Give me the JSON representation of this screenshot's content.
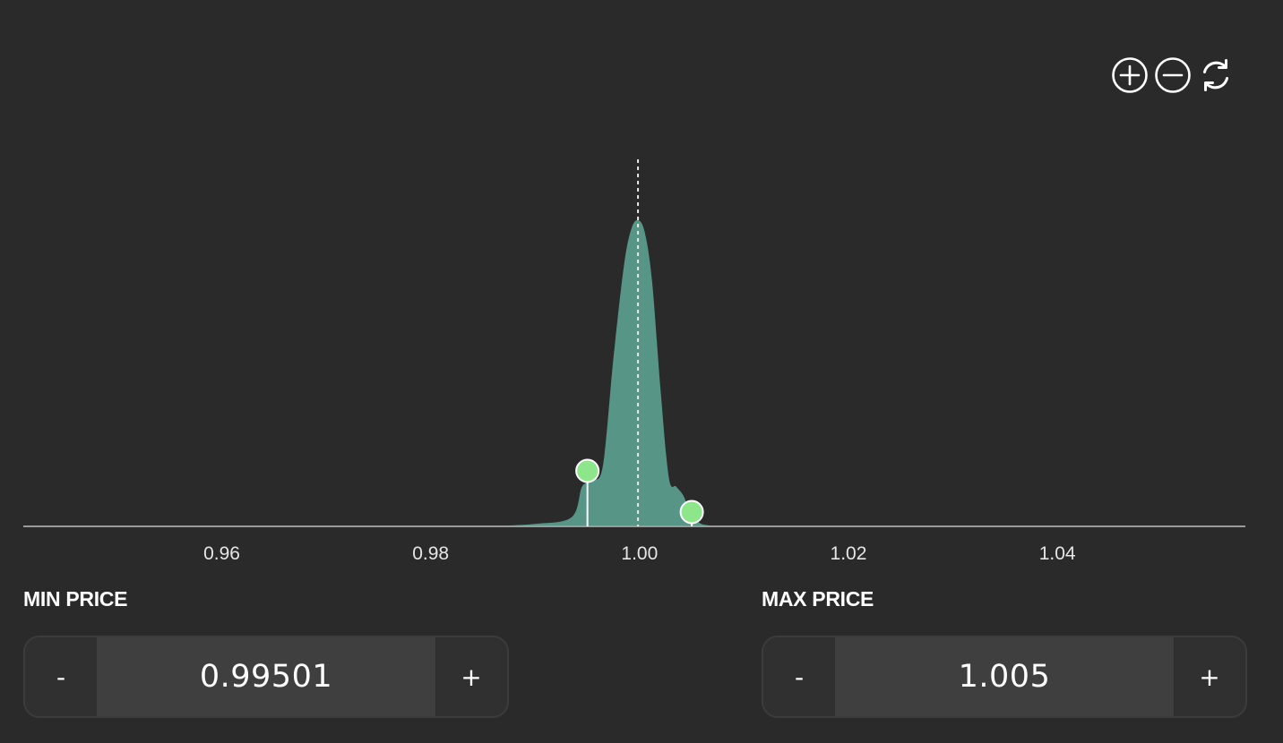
{
  "toolbar": {
    "zoom_in_icon": "plus-circle-icon",
    "zoom_out_icon": "minus-circle-icon",
    "reset_icon": "refresh-icon"
  },
  "chart_data": {
    "type": "area",
    "xlim": [
      0.941,
      1.058
    ],
    "x_ticks": [
      0.96,
      0.98,
      1.0,
      1.02,
      1.04
    ],
    "tick_labels": [
      "0.96",
      "0.98",
      "1.00",
      "1.02",
      "1.04"
    ],
    "current_price": 0.99985,
    "range_min": 0.99501,
    "range_max": 1.005,
    "x": [
      0.985,
      0.99,
      0.9935,
      0.9945,
      0.9955,
      0.9965,
      0.9975,
      0.9985,
      0.9992,
      0.99985,
      1.0005,
      1.0012,
      1.002,
      1.0028,
      1.0035,
      1.0042,
      1.0048,
      1.0058,
      1.0075,
      1.01
    ],
    "y": [
      0.0,
      0.008,
      0.03,
      0.13,
      0.15,
      0.2,
      0.55,
      0.85,
      0.97,
      1.0,
      0.96,
      0.8,
      0.45,
      0.16,
      0.13,
      0.1,
      0.05,
      0.01,
      0.002,
      0.0
    ],
    "colors": {
      "area": "#5a9c8c",
      "handle": "#8ee68a",
      "axis": "#9a9a9a",
      "current_line": "#e8e8e8"
    }
  },
  "min_price": {
    "label": "MIN PRICE",
    "value": "0.99501",
    "decrement": "-",
    "increment": "+"
  },
  "max_price": {
    "label": "MAX PRICE",
    "value": "1.005",
    "decrement": "-",
    "increment": "+"
  }
}
